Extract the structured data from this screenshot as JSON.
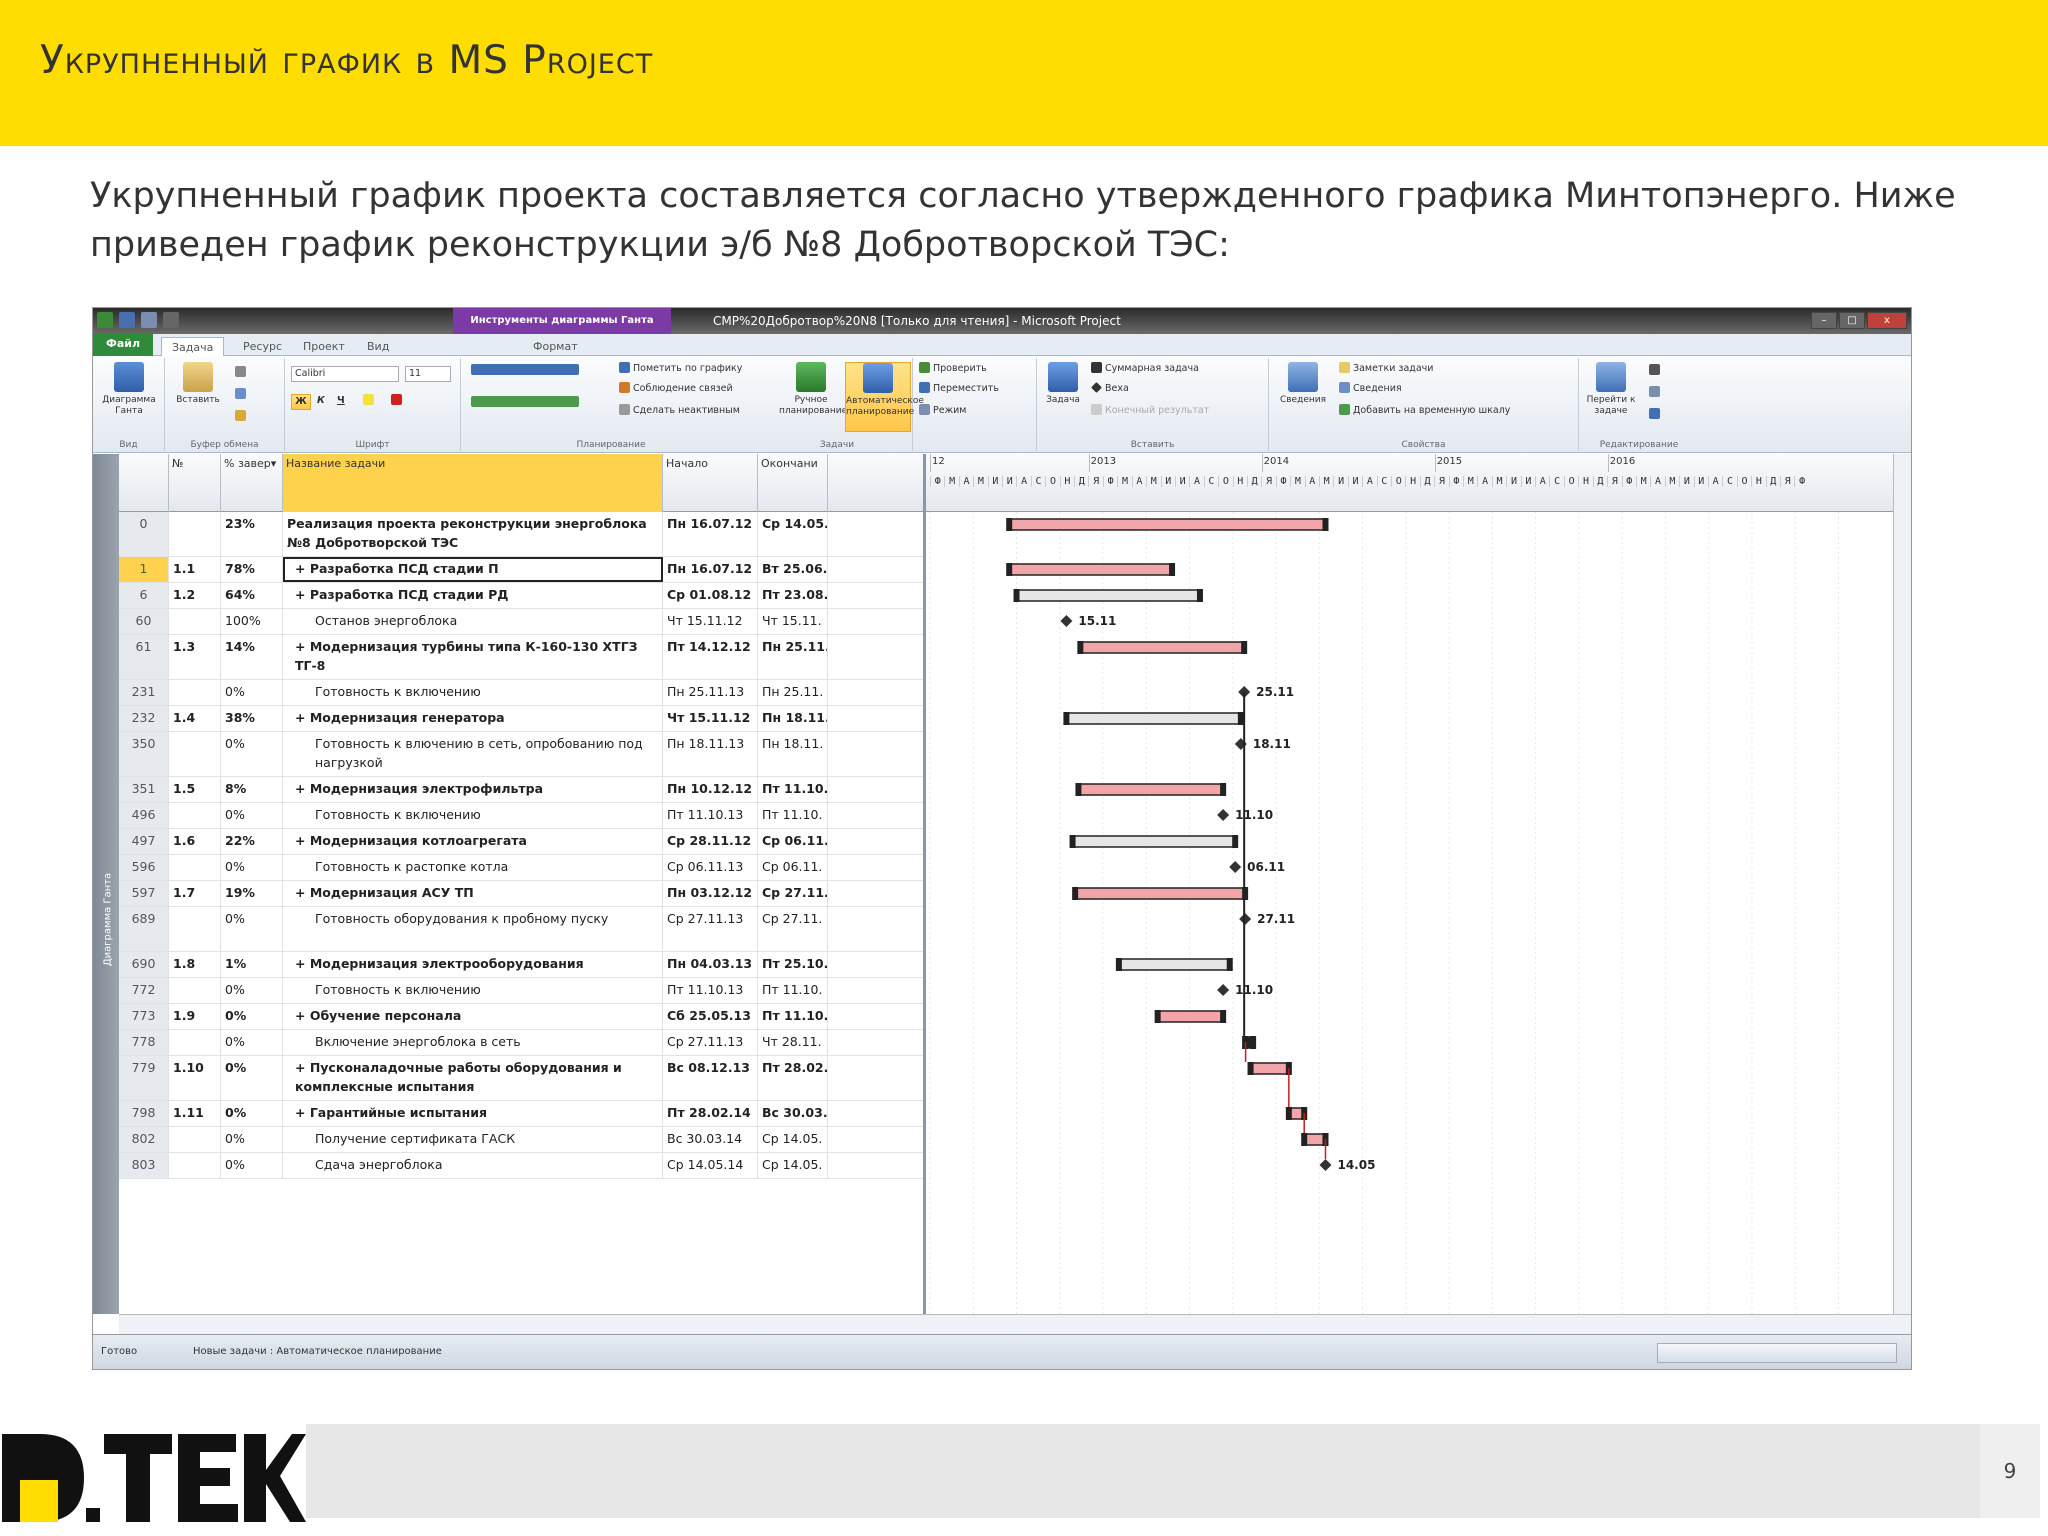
{
  "slide": {
    "title": "Укрупненный график в MS Project",
    "intro": "Укрупненный график проекта составляется согласно утвержденного графика Минтопэнерго. Ниже приведен график реконструкции э/б №8 Добротворской ТЭС:",
    "page_number": "9",
    "logo_text": "D.TEK"
  },
  "window": {
    "context_tab": "Инструменты диаграммы Ганта",
    "title": "СМР%20Добротвор%20N8 [Только для чтения] - Microsoft Project",
    "controls": [
      "–",
      "□",
      "x"
    ]
  },
  "tabs": [
    "Файл",
    "Задача",
    "Ресурс",
    "Проект",
    "Вид",
    "Формат"
  ],
  "ribbon": {
    "view_group": {
      "label": "Вид",
      "btn": "Диаграмма Ганта"
    },
    "clipboard_group": {
      "label": "Буфер обмена",
      "paste": "Вставить"
    },
    "font_group": {
      "label": "Шрифт",
      "font": "Calibri",
      "size": "11",
      "bold": "Ж",
      "italic": "К",
      "underline": "Ч"
    },
    "schedule_group": {
      "label": "Планирование",
      "mark": "Пометить по графику",
      "respect": "Соблюдение связей",
      "inactive": "Сделать неактивным"
    },
    "tasks_group": {
      "label": "Задачи",
      "manual": "Ручное планирование",
      "auto": "Автоматическое планирование",
      "inspect": "Проверить",
      "move": "Переместить",
      "mode": "Режим"
    },
    "insert_group": {
      "label": "Вставить",
      "task": "Задача",
      "summary": "Суммарная задача",
      "milestone": "Веха",
      "deliverable": "Конечный результат"
    },
    "props_group": {
      "label": "Свойства",
      "info": "Сведения",
      "notes": "Заметки задачи",
      "details": "Сведения",
      "timeline": "Добавить на временную шкалу"
    },
    "edit_group": {
      "label": "Редактирование",
      "goto": "Перейти к задаче"
    }
  },
  "side_label": "Диаграмма Ганта",
  "grid": {
    "headers": {
      "id": "",
      "wbs": "№",
      "pct": "% завер▾",
      "name": "Название задачи",
      "start": "Начало",
      "finish": "Окончани"
    },
    "rows": [
      {
        "id": "0",
        "wbs": "",
        "pct": "23%",
        "name": "Реализация проекта реконструкции энергоблока №8 Добротворской ТЭС",
        "start": "Пн 16.07.12",
        "finish": "Ср 14.05.",
        "bold": true,
        "level": 0,
        "lines": 2
      },
      {
        "id": "1",
        "wbs": "1.1",
        "pct": "78%",
        "name": "Разработка ПСД стадии П",
        "start": "Пн 16.07.12",
        "finish": "Вт 25.06.",
        "bold": true,
        "level": 1,
        "lines": 1,
        "selected": true
      },
      {
        "id": "6",
        "wbs": "1.2",
        "pct": "64%",
        "name": "Разработка ПСД стадии РД",
        "start": "Ср 01.08.12",
        "finish": "Пт 23.08.",
        "bold": true,
        "level": 1,
        "lines": 1
      },
      {
        "id": "60",
        "wbs": "",
        "pct": "100%",
        "name": "Останов энергоблока",
        "start": "Чт 15.11.12",
        "finish": "Чт 15.11.",
        "bold": false,
        "level": 2,
        "lines": 1
      },
      {
        "id": "61",
        "wbs": "1.3",
        "pct": "14%",
        "name": "Модернизация турбины типа К-160-130 ХТГЗ ТГ-8",
        "start": "Пт 14.12.12",
        "finish": "Пн 25.11.",
        "bold": true,
        "level": 1,
        "lines": 2
      },
      {
        "id": "231",
        "wbs": "",
        "pct": "0%",
        "name": "Готовность к включению",
        "start": "Пн 25.11.13",
        "finish": "Пн 25.11.",
        "bold": false,
        "level": 2,
        "lines": 1
      },
      {
        "id": "232",
        "wbs": "1.4",
        "pct": "38%",
        "name": "Модернизация генератора",
        "start": "Чт 15.11.12",
        "finish": "Пн 18.11.",
        "bold": true,
        "level": 1,
        "lines": 1
      },
      {
        "id": "350",
        "wbs": "",
        "pct": "0%",
        "name": "Готовность к влючению в сеть, опробованию под нагрузкой",
        "start": "Пн 18.11.13",
        "finish": "Пн 18.11.",
        "bold": false,
        "level": 2,
        "lines": 2
      },
      {
        "id": "351",
        "wbs": "1.5",
        "pct": "8%",
        "name": "Модернизация электрофильтра",
        "start": "Пн 10.12.12",
        "finish": "Пт 11.10.",
        "bold": true,
        "level": 1,
        "lines": 1
      },
      {
        "id": "496",
        "wbs": "",
        "pct": "0%",
        "name": "Готовность к включению",
        "start": "Пт 11.10.13",
        "finish": "Пт 11.10.",
        "bold": false,
        "level": 2,
        "lines": 1
      },
      {
        "id": "497",
        "wbs": "1.6",
        "pct": "22%",
        "name": "Модернизация котлоагрегата",
        "start": "Ср 28.11.12",
        "finish": "Ср 06.11.",
        "bold": true,
        "level": 1,
        "lines": 1
      },
      {
        "id": "596",
        "wbs": "",
        "pct": "0%",
        "name": "Готовность к растопке котла",
        "start": "Ср 06.11.13",
        "finish": "Ср 06.11.",
        "bold": false,
        "level": 2,
        "lines": 1
      },
      {
        "id": "597",
        "wbs": "1.7",
        "pct": "19%",
        "name": "Модернизация АСУ ТП",
        "start": "Пн 03.12.12",
        "finish": "Ср 27.11.",
        "bold": true,
        "level": 1,
        "lines": 1
      },
      {
        "id": "689",
        "wbs": "",
        "pct": "0%",
        "name": "Готовность оборудования к пробному пуску",
        "start": "Ср 27.11.13",
        "finish": "Ср 27.11.",
        "bold": false,
        "level": 2,
        "lines": 2
      },
      {
        "id": "690",
        "wbs": "1.8",
        "pct": "1%",
        "name": "Модернизация электрооборудования",
        "start": "Пн 04.03.13",
        "finish": "Пт 25.10.",
        "bold": true,
        "level": 1,
        "lines": 1
      },
      {
        "id": "772",
        "wbs": "",
        "pct": "0%",
        "name": "Готовность к включению",
        "start": "Пт 11.10.13",
        "finish": "Пт 11.10.",
        "bold": false,
        "level": 2,
        "lines": 1
      },
      {
        "id": "773",
        "wbs": "1.9",
        "pct": "0%",
        "name": "Обучение персонала",
        "start": "Сб 25.05.13",
        "finish": "Пт 11.10.",
        "bold": true,
        "level": 1,
        "lines": 1
      },
      {
        "id": "778",
        "wbs": "",
        "pct": "0%",
        "name": "Включение энергоблока в сеть",
        "start": "Ср 27.11.13",
        "finish": "Чт 28.11.",
        "bold": false,
        "level": 2,
        "lines": 1
      },
      {
        "id": "779",
        "wbs": "1.10",
        "pct": "0%",
        "name": "Пусконаладочные работы оборудования и комплексные испытания",
        "start": "Вс 08.12.13",
        "finish": "Пт 28.02.",
        "bold": true,
        "level": 1,
        "lines": 2
      },
      {
        "id": "798",
        "wbs": "1.11",
        "pct": "0%",
        "name": "Гарантийные испытания",
        "start": "Пт 28.02.14",
        "finish": "Вс 30.03.",
        "bold": true,
        "level": 1,
        "lines": 1
      },
      {
        "id": "802",
        "wbs": "",
        "pct": "0%",
        "name": "Получение сертификата ГАСК",
        "start": "Вс 30.03.14",
        "finish": "Ср 14.05.",
        "bold": false,
        "level": 2,
        "lines": 1
      },
      {
        "id": "803",
        "wbs": "",
        "pct": "0%",
        "name": "Сдача энергоблока",
        "start": "Ср 14.05.14",
        "finish": "Ср 14.05.",
        "bold": false,
        "level": 2,
        "lines": 1
      }
    ]
  },
  "timescale": {
    "years": [
      "12",
      "2013",
      "2014",
      "2015",
      "2016"
    ],
    "months": "ФМАМИИАСОНДЯФМАМИИАСОНДЯФМАМИИАСОНДЯФМАМИИАСОНДЯФМАМИИАСОНДЯФ"
  },
  "gantt": {
    "bars": [
      {
        "row": 0,
        "start": "2012-07-16",
        "end": "2014-05-14",
        "style": "red"
      },
      {
        "row": 1,
        "start": "2012-07-16",
        "end": "2013-06-25",
        "style": "red"
      },
      {
        "row": 2,
        "start": "2012-08-01",
        "end": "2013-08-23",
        "style": "gray"
      },
      {
        "row": 3,
        "milestone": "2012-11-15",
        "label": "15.11"
      },
      {
        "row": 4,
        "start": "2012-12-14",
        "end": "2013-11-25",
        "style": "red"
      },
      {
        "row": 5,
        "milestone": "2013-11-25",
        "label": "25.11"
      },
      {
        "row": 6,
        "start": "2012-11-15",
        "end": "2013-11-18",
        "style": "gray"
      },
      {
        "row": 7,
        "milestone": "2013-11-18",
        "label": "18.11"
      },
      {
        "row": 8,
        "start": "2012-12-10",
        "end": "2013-10-11",
        "style": "red"
      },
      {
        "row": 9,
        "milestone": "2013-10-11",
        "label": "11.10"
      },
      {
        "row": 10,
        "start": "2012-11-28",
        "end": "2013-11-06",
        "style": "gray"
      },
      {
        "row": 11,
        "milestone": "2013-11-06",
        "label": "06.11"
      },
      {
        "row": 12,
        "start": "2012-12-03",
        "end": "2013-11-27",
        "style": "red"
      },
      {
        "row": 13,
        "milestone": "2013-11-27",
        "label": "27.11"
      },
      {
        "row": 14,
        "start": "2013-03-04",
        "end": "2013-10-25",
        "style": "gray"
      },
      {
        "row": 15,
        "milestone": "2013-10-11",
        "label": "11.10"
      },
      {
        "row": 16,
        "start": "2013-05-25",
        "end": "2013-10-11",
        "style": "red"
      },
      {
        "row": 17,
        "start": "2013-11-27",
        "end": "2013-11-28",
        "style": "dark"
      },
      {
        "row": 18,
        "start": "2013-12-08",
        "end": "2014-02-28",
        "style": "red"
      },
      {
        "row": 19,
        "start": "2014-02-28",
        "end": "2014-03-30",
        "style": "red"
      },
      {
        "row": 20,
        "start": "2014-03-30",
        "end": "2014-05-14",
        "style": "red"
      },
      {
        "row": 21,
        "milestone": "2014-05-14",
        "label": "14.05"
      }
    ]
  },
  "status": {
    "ready": "Готово",
    "new_tasks": "Новые задачи : Автоматическое планирование"
  }
}
